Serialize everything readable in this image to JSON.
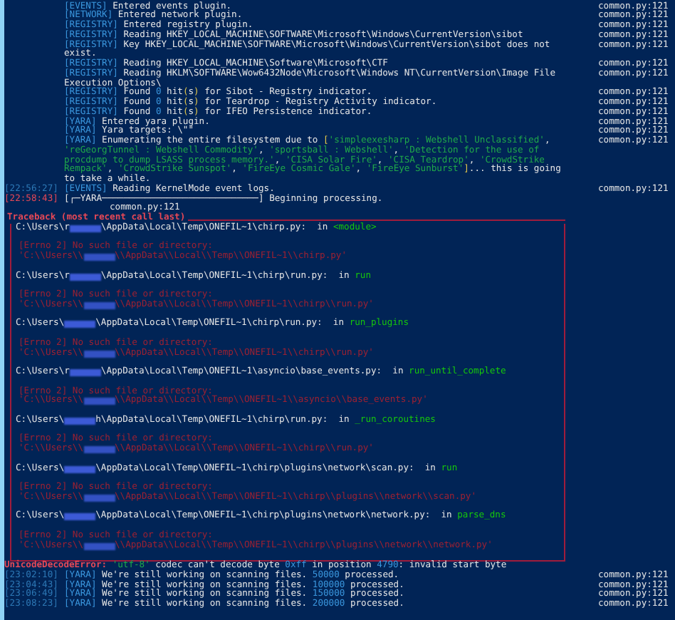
{
  "log_lines": [
    {
      "kind": "log",
      "tag": {
        "text": "[EVENTS]",
        "kind": "plugin"
      },
      "spans": [
        {
          "text": " Entered events plugin.",
          "kind": "plain"
        }
      ],
      "source": "common.py:121"
    },
    {
      "kind": "log",
      "tag": {
        "text": "[NETWORK]",
        "kind": "plugin"
      },
      "spans": [
        {
          "text": " Entered network plugin.",
          "kind": "plain"
        }
      ],
      "source": "common.py:121"
    },
    {
      "kind": "log",
      "tag": {
        "text": "[REGISTRY]",
        "kind": "plugin"
      },
      "spans": [
        {
          "text": " Entered registry plugin.",
          "kind": "plain"
        }
      ],
      "source": "common.py:121"
    },
    {
      "kind": "log",
      "tag": {
        "text": "[REGISTRY]",
        "kind": "plugin"
      },
      "spans": [
        {
          "text": " Reading HKEY_LOCAL_MACHINE\\SOFTWARE\\Microsoft\\Windows\\CurrentVersion\\sibot",
          "kind": "plain"
        }
      ],
      "source": "common.py:121"
    },
    {
      "kind": "log",
      "tag": {
        "text": "[REGISTRY]",
        "kind": "plugin"
      },
      "spans": [
        {
          "text": " Key HKEY_LOCAL_MACHINE\\SOFTWARE\\Microsoft\\Windows\\CurrentVersion\\sibot does not",
          "kind": "plain"
        }
      ],
      "source": "common.py:121"
    },
    {
      "kind": "cont",
      "spans": [
        {
          "text": "exist.",
          "kind": "plain"
        }
      ]
    },
    {
      "kind": "log",
      "tag": {
        "text": "[REGISTRY]",
        "kind": "plugin"
      },
      "spans": [
        {
          "text": " Reading HKEY_LOCAL_MACHINE\\Software\\Microsoft\\CTF",
          "kind": "plain"
        }
      ],
      "source": "common.py:121"
    },
    {
      "kind": "log",
      "tag": {
        "text": "[REGISTRY]",
        "kind": "plugin"
      },
      "spans": [
        {
          "text": " Reading HKLM\\SOFTWARE\\Wow6432Node\\Microsoft\\Windows NT\\CurrentVersion\\Image File",
          "kind": "plain"
        }
      ],
      "source": "common.py:121"
    },
    {
      "kind": "cont",
      "spans": [
        {
          "text": "Execution Options\\",
          "kind": "plain"
        }
      ]
    },
    {
      "kind": "log",
      "tag": {
        "text": "[REGISTRY]",
        "kind": "plugin"
      },
      "spans": [
        {
          "text": " Found ",
          "kind": "plain"
        },
        {
          "text": "0",
          "kind": "num"
        },
        {
          "text": " hit",
          "kind": "plain"
        },
        {
          "text": "(",
          "kind": "paren"
        },
        {
          "text": "s",
          "kind": "plain"
        },
        {
          "text": ")",
          "kind": "paren"
        },
        {
          "text": " for Sibot - Registry indicator.",
          "kind": "plain"
        }
      ],
      "source": "common.py:121"
    },
    {
      "kind": "log",
      "tag": {
        "text": "[REGISTRY]",
        "kind": "plugin"
      },
      "spans": [
        {
          "text": " Found ",
          "kind": "plain"
        },
        {
          "text": "0",
          "kind": "num"
        },
        {
          "text": " hit",
          "kind": "plain"
        },
        {
          "text": "(",
          "kind": "paren"
        },
        {
          "text": "s",
          "kind": "plain"
        },
        {
          "text": ")",
          "kind": "paren"
        },
        {
          "text": " for Teardrop - Registry Activity indicator.",
          "kind": "plain"
        }
      ],
      "source": "common.py:121"
    },
    {
      "kind": "log",
      "tag": {
        "text": "[REGISTRY]",
        "kind": "plugin"
      },
      "spans": [
        {
          "text": " Found ",
          "kind": "plain"
        },
        {
          "text": "0",
          "kind": "num"
        },
        {
          "text": " hit",
          "kind": "plain"
        },
        {
          "text": "(",
          "kind": "paren"
        },
        {
          "text": "s",
          "kind": "plain"
        },
        {
          "text": ")",
          "kind": "paren"
        },
        {
          "text": " for IFEO Persistence indicator.",
          "kind": "plain"
        }
      ],
      "source": "common.py:121"
    },
    {
      "kind": "log",
      "tag": {
        "text": "[YARA]",
        "kind": "plugin"
      },
      "spans": [
        {
          "text": " Entered yara plugin.",
          "kind": "plain"
        }
      ],
      "source": "common.py:121"
    },
    {
      "kind": "log",
      "tag": {
        "text": "[YARA]",
        "kind": "plugin"
      },
      "spans": [
        {
          "text": " Yara targets: \\\"\"",
          "kind": "plain"
        }
      ],
      "source": "common.py:121"
    },
    {
      "kind": "log",
      "tag": {
        "text": "[YARA]",
        "kind": "plugin"
      },
      "spans": [
        {
          "text": " Enumerating the entire filesystem due to ",
          "kind": "plain"
        },
        {
          "text": "[",
          "kind": "paren"
        },
        {
          "text": "'simpleexesharp : Webshell Unclassified'",
          "kind": "str"
        },
        {
          "text": ",",
          "kind": "plain"
        }
      ],
      "source": "common.py:121"
    },
    {
      "kind": "cont",
      "spans": [
        {
          "text": "'reGeorgTunnel : Webshell Commodity'",
          "kind": "str"
        },
        {
          "text": ", ",
          "kind": "plain"
        },
        {
          "text": "'sportsball : Webshell'",
          "kind": "str"
        },
        {
          "text": ", ",
          "kind": "plain"
        },
        {
          "text": "'Detection for the use of",
          "kind": "str"
        }
      ]
    },
    {
      "kind": "cont",
      "spans": [
        {
          "text": "procdump to dump LSASS process memory.'",
          "kind": "str"
        },
        {
          "text": ", ",
          "kind": "plain"
        },
        {
          "text": "'CISA Solar Fire'",
          "kind": "str"
        },
        {
          "text": ", ",
          "kind": "plain"
        },
        {
          "text": "'CISA Teardrop'",
          "kind": "str"
        },
        {
          "text": ", ",
          "kind": "plain"
        },
        {
          "text": "'CrowdStrike",
          "kind": "str"
        }
      ]
    },
    {
      "kind": "cont",
      "spans": [
        {
          "text": "Rempack'",
          "kind": "str"
        },
        {
          "text": ", ",
          "kind": "plain"
        },
        {
          "text": "'CrowdStrike Sunspot'",
          "kind": "str"
        },
        {
          "text": ", ",
          "kind": "plain"
        },
        {
          "text": "'FireEye Cosmic Gale'",
          "kind": "str"
        },
        {
          "text": ", ",
          "kind": "plain"
        },
        {
          "text": "'FireEye Sunburst'",
          "kind": "str"
        },
        {
          "text": "]",
          "kind": "paren"
        },
        {
          "text": "... this is going",
          "kind": "plain"
        }
      ]
    },
    {
      "kind": "cont",
      "spans": [
        {
          "text": "to take a while.",
          "kind": "plain"
        }
      ]
    },
    {
      "kind": "log",
      "time": {
        "text": "[22:56:27]",
        "kind": "info"
      },
      "tag": {
        "text": "[EVENTS]",
        "kind": "plugin"
      },
      "spans": [
        {
          "text": " Reading KernelMode event logs.",
          "kind": "plain"
        }
      ],
      "source": "common.py:121"
    },
    {
      "kind": "log",
      "time": {
        "text": "[22:58:43]",
        "kind": "error"
      },
      "tag": {
        "text": "[┌─YARA─────────────────────────────]",
        "kind": "progress"
      },
      "spans": [
        {
          "text": " Beginning processing.",
          "kind": "plain"
        }
      ]
    },
    {
      "kind": "source",
      "source": "common.py:121"
    }
  ],
  "traceback": {
    "title": "Traceback (most recent call last)",
    "frames": [
      {
        "path_start": "C:\\Users\\r",
        "path_end": "\\AppData\\Local\\Temp\\ONEFIL~1\\chirp.py:",
        "keyword": "in",
        "function": "<module>",
        "error": "[Errno 2] No such file or directory:",
        "error_path_start": "'C:\\\\Users\\\\",
        "error_path_end": "\\\\AppData\\\\Local\\\\Temp\\\\ONEFIL~1\\\\chirp.py'"
      },
      {
        "path_start": "C:\\Users\\r",
        "path_end": "\\AppData\\Local\\Temp\\ONEFIL~1\\chirp\\run.py:",
        "keyword": "in",
        "function": "run",
        "error": "[Errno 2] No such file or directory:",
        "error_path_start": "'C:\\\\Users\\\\",
        "error_path_end": "\\\\AppData\\\\Local\\\\Temp\\\\ONEFIL~1\\\\chirp\\\\run.py'"
      },
      {
        "path_start": "C:\\Users\\",
        "path_end": "\\AppData\\Local\\Temp\\ONEFIL~1\\chirp\\run.py:",
        "keyword": "in",
        "function": "run_plugins",
        "error": "[Errno 2] No such file or directory:",
        "error_path_start": "'C:\\\\Users\\\\",
        "error_path_end": "\\\\AppData\\\\Local\\\\Temp\\\\ONEFIL~1\\\\chirp\\\\run.py'"
      },
      {
        "path_start": "C:\\Users\\r",
        "path_end": "\\AppData\\Local\\Temp\\ONEFIL~1\\asyncio\\base_events.py:",
        "keyword": "in",
        "function": "run_until_complete",
        "error": "[Errno 2] No such file or directory:",
        "error_path_start": "'C:\\\\Users\\\\",
        "error_path_end": "\\\\AppData\\\\Local\\\\Temp\\\\ONEFIL~1\\\\asyncio\\\\base_events.py'"
      },
      {
        "path_start": "C:\\Users\\",
        "path_end": "h\\AppData\\Local\\Temp\\ONEFIL~1\\chirp\\run.py:",
        "keyword": "in",
        "function": "_run_coroutines",
        "error": "[Errno 2] No such file or directory:",
        "error_path_start": "'C:\\\\Users\\\\",
        "error_path_end": "\\\\AppData\\\\Local\\\\Temp\\\\ONEFIL~1\\\\chirp\\\\run.py'"
      },
      {
        "path_start": "C:\\Users\\",
        "path_end": "\\AppData\\Local\\Temp\\ONEFIL~1\\chirp\\plugins\\network\\scan.py:",
        "keyword": "in",
        "function": "run",
        "error": "[Errno 2] No such file or directory:",
        "error_path_start": "'C:\\\\Users\\\\",
        "error_path_end": "\\\\AppData\\\\Local\\\\Temp\\\\ONEFIL~1\\\\chirp\\\\plugins\\\\network\\\\scan.py'"
      },
      {
        "path_start": "C:\\Users\\",
        "path_end": "\\AppData\\Local\\Temp\\ONEFIL~1\\chirp\\plugins\\network\\network.py:",
        "keyword": "in",
        "function": "parse_dns",
        "error": "[Errno 2] No such file or directory:",
        "error_path_start": "'C:\\\\Users\\\\",
        "error_path_end": "\\\\AppData\\\\Local\\\\Temp\\\\ONEFIL~1\\\\chirp\\\\plugins\\\\network\\\\network.py'"
      }
    ]
  },
  "error_line": [
    {
      "text": "UnicodeDecodeError: ",
      "kind": "red"
    },
    {
      "text": "'utf-8'",
      "kind": "str"
    },
    {
      "text": " codec can't decode byte ",
      "kind": "plain"
    },
    {
      "text": "0xff",
      "kind": "num"
    },
    {
      "text": " in position ",
      "kind": "plain"
    },
    {
      "text": "4790",
      "kind": "num"
    },
    {
      "text": ": invalid start byte",
      "kind": "plain"
    }
  ],
  "progress_lines": [
    {
      "kind": "log",
      "time": {
        "text": "[23:02:10]",
        "kind": "info"
      },
      "tag": {
        "text": "[YARA]",
        "kind": "plugin"
      },
      "spans": [
        {
          "text": " We're still working on scanning files. ",
          "kind": "plain"
        },
        {
          "text": "50000",
          "kind": "num"
        },
        {
          "text": " processed.",
          "kind": "plain"
        }
      ],
      "source": "common.py:121"
    },
    {
      "kind": "log",
      "time": {
        "text": "[23:04:43]",
        "kind": "info"
      },
      "tag": {
        "text": "[YARA]",
        "kind": "plugin"
      },
      "spans": [
        {
          "text": " We're still working on scanning files. ",
          "kind": "plain"
        },
        {
          "text": "100000",
          "kind": "num"
        },
        {
          "text": " processed.",
          "kind": "plain"
        }
      ],
      "source": "common.py:121"
    },
    {
      "kind": "log",
      "time": {
        "text": "[23:06:49]",
        "kind": "info"
      },
      "tag": {
        "text": "[YARA]",
        "kind": "plugin"
      },
      "spans": [
        {
          "text": " We're still working on scanning files. ",
          "kind": "plain"
        },
        {
          "text": "150000",
          "kind": "num"
        },
        {
          "text": " processed.",
          "kind": "plain"
        }
      ],
      "source": "common.py:121"
    },
    {
      "kind": "log",
      "time": {
        "text": "[23:08:23]",
        "kind": "info"
      },
      "tag": {
        "text": "[YARA]",
        "kind": "plugin"
      },
      "spans": [
        {
          "text": " We're still working on scanning files. ",
          "kind": "plain"
        },
        {
          "text": "200000",
          "kind": "num"
        },
        {
          "text": " processed.",
          "kind": "plain"
        }
      ],
      "source": "common.py:121"
    }
  ]
}
